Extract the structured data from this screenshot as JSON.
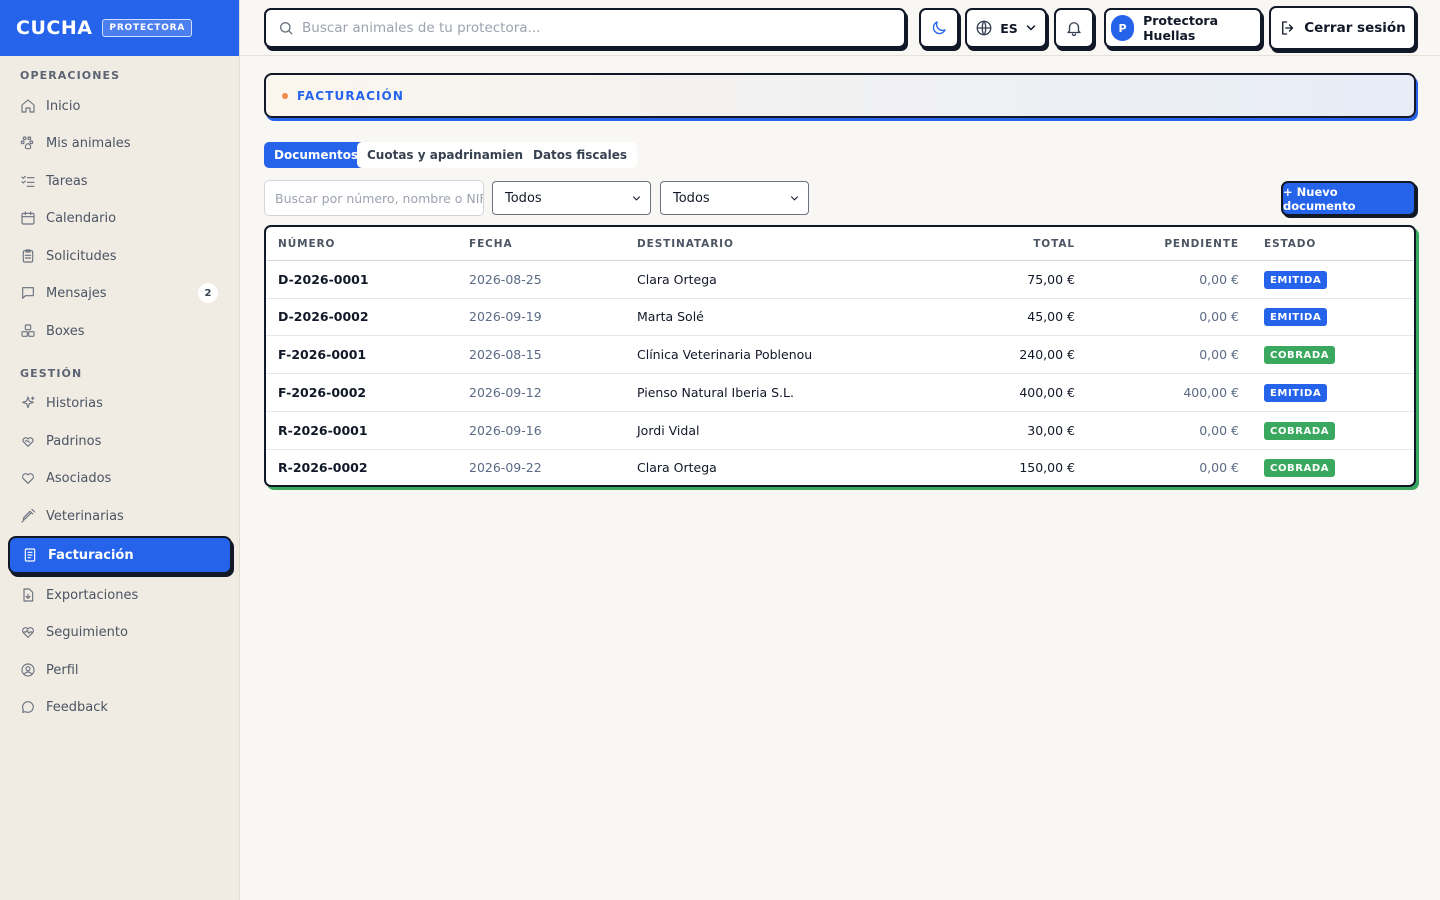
{
  "app": {
    "name": "CUCHA",
    "badge": "PROTECTORA"
  },
  "sidebar": {
    "sections": [
      {
        "title": "OPERACIONES"
      },
      {
        "title": "GESTIÓN"
      }
    ],
    "items": [
      {
        "label": "Inicio",
        "icon": "home-icon"
      },
      {
        "label": "Mis animales",
        "icon": "paw-icon"
      },
      {
        "label": "Tareas",
        "icon": "checklist-icon"
      },
      {
        "label": "Calendario",
        "icon": "calendar-icon"
      },
      {
        "label": "Solicitudes",
        "icon": "clipboard-icon"
      },
      {
        "label": "Mensajes",
        "icon": "message-icon",
        "badge": "2"
      },
      {
        "label": "Boxes",
        "icon": "boxes-icon"
      },
      {
        "label": "Historias",
        "icon": "sparkle-icon"
      },
      {
        "label": "Padrinos",
        "icon": "heart-hand-icon"
      },
      {
        "label": "Asociados",
        "icon": "heart-icon"
      },
      {
        "label": "Veterinarias",
        "icon": "syringe-icon"
      },
      {
        "label": "Facturación",
        "icon": "invoice-icon",
        "active": true
      },
      {
        "label": "Exportaciones",
        "icon": "file-download-icon"
      },
      {
        "label": "Seguimiento",
        "icon": "heart-pulse-icon"
      },
      {
        "label": "Perfil",
        "icon": "user-circle-icon"
      },
      {
        "label": "Feedback",
        "icon": "chat-bubble-icon"
      }
    ]
  },
  "topbar": {
    "search_placeholder": "Buscar animales de tu protectora...",
    "language": "ES",
    "user_initial": "P",
    "user_name": "Protectora Huellas",
    "logout_label": "Cerrar sesión"
  },
  "page": {
    "title": "FACTURACIÓN"
  },
  "tabs": [
    {
      "label": "Documentos",
      "active": true
    },
    {
      "label": "Cuotas y apadrinamientos"
    },
    {
      "label": "Datos fiscales"
    }
  ],
  "filters": {
    "search_placeholder": "Buscar por número, nombre o NIF",
    "select_type": "Todos",
    "select_status": "Todos",
    "new_button": "+ Nuevo documento"
  },
  "table": {
    "headers": [
      "NÚMERO",
      "FECHA",
      "DESTINATARIO",
      "TOTAL",
      "PENDIENTE",
      "ESTADO"
    ],
    "rows": [
      {
        "numero": "D-2026-0001",
        "fecha": "2026-08-25",
        "destinatario": "Clara Ortega",
        "total": "75,00 €",
        "pendiente": "0,00 €",
        "estado": "EMITIDA"
      },
      {
        "numero": "D-2026-0002",
        "fecha": "2026-09-19",
        "destinatario": "Marta Solé",
        "total": "45,00 €",
        "pendiente": "0,00 €",
        "estado": "EMITIDA"
      },
      {
        "numero": "F-2026-0001",
        "fecha": "2026-08-15",
        "destinatario": "Clínica Veterinaria Poblenou",
        "total": "240,00 €",
        "pendiente": "0,00 €",
        "estado": "COBRADA"
      },
      {
        "numero": "F-2026-0002",
        "fecha": "2026-09-12",
        "destinatario": "Pienso Natural Iberia S.L.",
        "total": "400,00 €",
        "pendiente": "400,00 €",
        "estado": "EMITIDA"
      },
      {
        "numero": "R-2026-0001",
        "fecha": "2026-09-16",
        "destinatario": "Jordi Vidal",
        "total": "30,00 €",
        "pendiente": "0,00 €",
        "estado": "COBRADA"
      },
      {
        "numero": "R-2026-0002",
        "fecha": "2026-09-22",
        "destinatario": "Clara Ortega",
        "total": "150,00 €",
        "pendiente": "0,00 €",
        "estado": "COBRADA"
      }
    ]
  },
  "colors": {
    "accent": "#2563eb",
    "emitida": "#2563eb",
    "cobrada": "#3aa95f",
    "header_dot": "#f08a4b"
  }
}
